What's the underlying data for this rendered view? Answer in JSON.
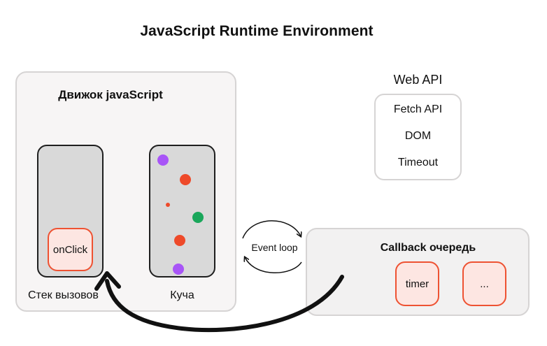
{
  "title": "JavaScript Runtime Environment",
  "engine": {
    "title": "Движок javaScript",
    "stack_label": "Стек вызовов",
    "heap_label": "Куча",
    "stack_item": "onClick"
  },
  "web_api": {
    "title": "Web API",
    "items": [
      "Fetch API",
      "DOM",
      "Timeout"
    ]
  },
  "event_loop": "Event loop",
  "callback_queue": {
    "title": "Callback очередь",
    "items": [
      "timer",
      "..."
    ]
  },
  "colors": {
    "purple": "#a855f7",
    "red": "#ee4a2a",
    "green": "#1aa75b",
    "pill_border": "#ee5232",
    "pill_fill": "#fde6e2"
  }
}
